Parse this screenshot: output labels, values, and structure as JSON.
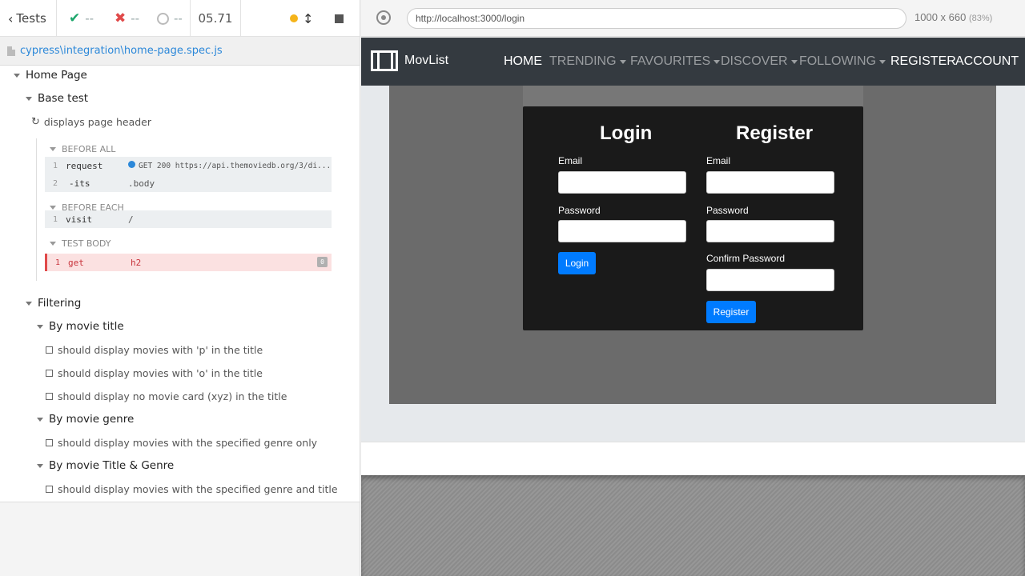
{
  "reporter": {
    "tests_label": "Tests",
    "passed": "--",
    "failed": "--",
    "pending": "--",
    "duration": "05.71",
    "spec_file": "cypress\\integration\\home-page.spec.js"
  },
  "runnables": {
    "suite_home": "Home Page",
    "suite_base": "Base test",
    "test_header": "displays page header",
    "hooks": {
      "before_all": "BEFORE ALL",
      "before_each": "BEFORE EACH",
      "test_body": "TEST BODY"
    },
    "commands": [
      {
        "num": "1",
        "name": "request",
        "msg": "GET 200 https://api.themoviedb.org/3/di..."
      },
      {
        "num": "2",
        "name": "-its",
        "msg": ".body"
      },
      {
        "num": "1",
        "name": "visit",
        "msg": "/"
      },
      {
        "num": "1",
        "name": "get",
        "msg": "h2",
        "badge": "0"
      }
    ],
    "suite_filtering": "Filtering",
    "suite_title": "By movie title",
    "tests_title": [
      "should display movies with 'p' in the title",
      "should display movies with 'o' in the title",
      "should display no movie card (xyz) in the title"
    ],
    "suite_genre": "By movie genre",
    "test_genre": "should display movies with the specified genre only",
    "suite_title_genre": "By movie Title & Genre",
    "test_title_genre": "should display movies with the specified genre and title"
  },
  "runner": {
    "url": "http://localhost:3000/login",
    "viewport": "1000 x 660",
    "scale": "(83%)"
  },
  "app": {
    "brand": "MovList",
    "nav": [
      {
        "label": "HOME",
        "active": true,
        "dropdown": false
      },
      {
        "label": "TRENDING",
        "active": false,
        "dropdown": true
      },
      {
        "label": "FAVOURITES",
        "active": false,
        "dropdown": true
      },
      {
        "label": "DISCOVER",
        "active": false,
        "dropdown": true
      },
      {
        "label": "FOLLOWING",
        "active": false,
        "dropdown": true
      },
      {
        "label": "REGISTER",
        "active": true,
        "dropdown": false
      },
      {
        "label": "ACCOUNT",
        "active": true,
        "dropdown": false
      }
    ],
    "login": {
      "title": "Login",
      "email_label": "Email",
      "password_label": "Password",
      "button": "Login"
    },
    "register": {
      "title": "Register",
      "email_label": "Email",
      "password_label": "Password",
      "confirm_label": "Confirm Password",
      "button": "Register"
    }
  },
  "colors": {
    "accent": "#2c88d9",
    "pass": "#1ba66b",
    "fail": "#e04949",
    "running": "#f5b41a",
    "primary_button": "#007bff",
    "navbar": "#343a40"
  }
}
